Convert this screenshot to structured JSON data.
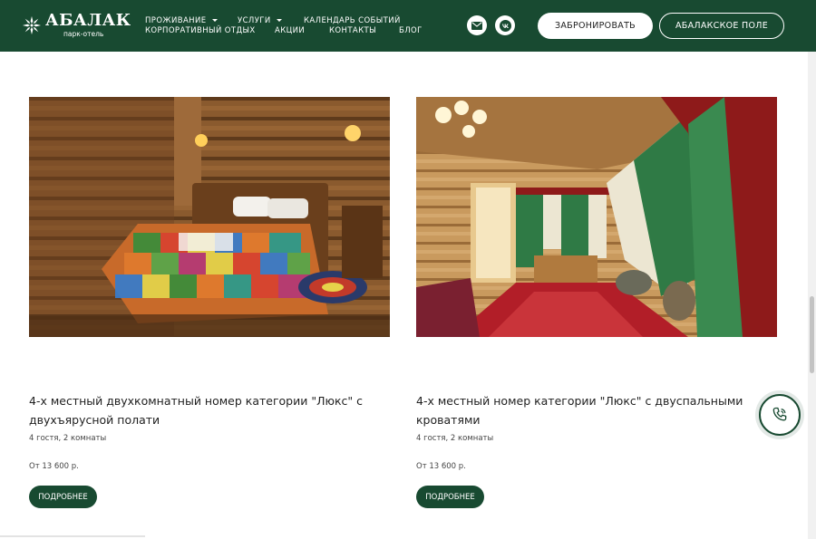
{
  "header": {
    "logo": {
      "name": "АБАЛАК",
      "subtitle": "парк-отель",
      "icon": "snowflake-icon"
    },
    "nav": [
      {
        "label": "ПРОЖИВАНИЕ",
        "has_dropdown": true
      },
      {
        "label": "УСЛУГИ",
        "has_dropdown": true
      },
      {
        "label": "КАЛЕНДАРЬ СОБЫТИЙ",
        "has_dropdown": false
      },
      {
        "label": "КОРПОРАТИВНЫЙ ОТДЫХ",
        "has_dropdown": false
      },
      {
        "label": "АКЦИИ",
        "has_dropdown": false
      },
      {
        "label": "КОНТАКТЫ",
        "has_dropdown": false
      },
      {
        "label": "БЛОГ",
        "has_dropdown": false
      }
    ],
    "icons": [
      "mail-icon",
      "vk-icon"
    ],
    "book_button": "ЗАБРОНИРОВАТЬ",
    "field_button": "АБАЛАКСКОЕ ПОЛЕ"
  },
  "rooms": [
    {
      "title": "4-х местный двухкомнатный номер категории \"Люкс\" с двухъярусной полати",
      "meta": "4 гостя, 2 комнаты",
      "price": "От 13 600 р.",
      "button": "ПОДРОБНЕЕ",
      "image": "log-cabin-bedroom-with-patchwork-quilt"
    },
    {
      "title": "4-х местный номер категории \"Люкс\" с двуспальными кроватями",
      "meta": "4 гостя, 2 комнаты",
      "price": "От 13 600 р.",
      "button": "ПОДРОБНЕЕ",
      "image": "log-cabin-room-with-red-green-curtains"
    }
  ],
  "floating": {
    "icon": "phone-icon"
  },
  "colors": {
    "brand": "#184a31",
    "white": "#ffffff"
  }
}
